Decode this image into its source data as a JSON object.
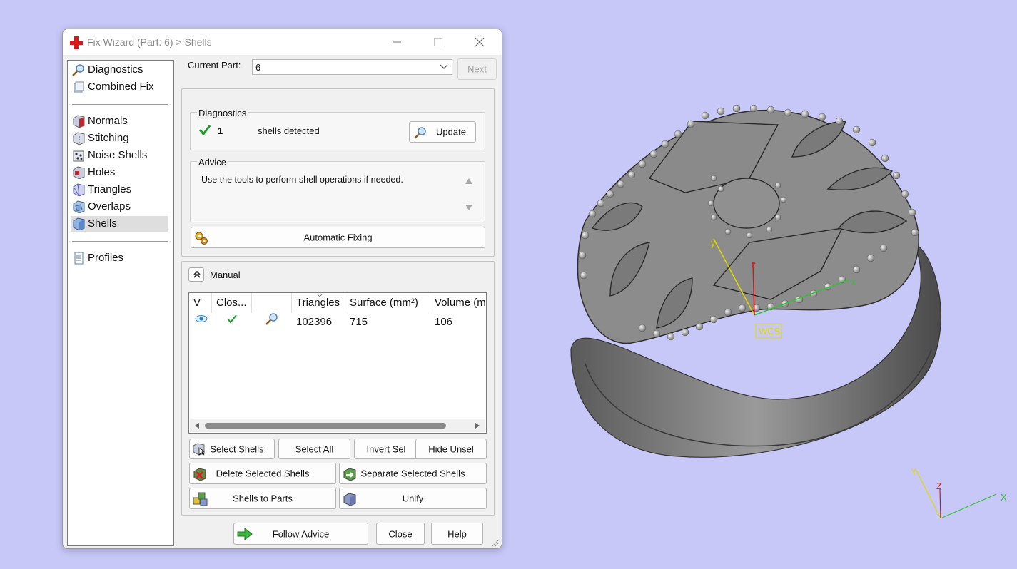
{
  "window": {
    "title": "Fix Wizard (Part: 6) > Shells",
    "controls": [
      "minimize",
      "maximize",
      "close"
    ]
  },
  "nav": {
    "items": [
      {
        "label": "Diagnostics",
        "icon": "magnifier-icon"
      },
      {
        "label": "Combined Fix",
        "icon": "combined-fix-icon"
      },
      {
        "label": "Normals",
        "icon": "normals-icon"
      },
      {
        "label": "Stitching",
        "icon": "stitching-icon"
      },
      {
        "label": "Noise Shells",
        "icon": "noise-shells-icon"
      },
      {
        "label": "Holes",
        "icon": "holes-icon"
      },
      {
        "label": "Triangles",
        "icon": "triangles-icon"
      },
      {
        "label": "Overlaps",
        "icon": "overlaps-icon"
      },
      {
        "label": "Shells",
        "icon": "shells-icon",
        "selected": true
      },
      {
        "label": "Profiles",
        "icon": "profiles-icon"
      }
    ]
  },
  "part": {
    "label": "Current Part:",
    "value": "6",
    "next_label": "Next"
  },
  "diagnostics": {
    "title": "Diagnostics",
    "count": "1",
    "status_text": "shells detected",
    "update_label": "Update"
  },
  "advice": {
    "title": "Advice",
    "text": "Use the tools to perform shell operations if needed."
  },
  "automatic_fixing_label": "Automatic Fixing",
  "manual": {
    "title": "Manual",
    "columns": [
      "V",
      "Clos...",
      "",
      "Triangles",
      "Surface (mm²)",
      "Volume (m"
    ],
    "rows": [
      {
        "triangles": "102396",
        "surface": "715",
        "volume": "106"
      }
    ]
  },
  "buttons": {
    "select_shells": "Select Shells",
    "select_all": "Select All",
    "invert_sel": "Invert Sel",
    "hide_unsel": "Hide Unsel",
    "delete_selected": "Delete Selected Shells",
    "separate_selected": "Separate Selected Shells",
    "shells_to_parts": "Shells to Parts",
    "unify": "Unify",
    "follow_advice": "Follow Advice",
    "close": "Close",
    "help": "Help"
  },
  "viewport": {
    "wcs_label": "WCS",
    "axis_x": "x",
    "axis_y": "y",
    "axis_z": "z",
    "corner_x": "X",
    "corner_y": "Y",
    "corner_z": "Z"
  },
  "colors": {
    "background": "#c8c8f8",
    "axis_x": "#2fc42f",
    "axis_y": "#e0d800",
    "axis_z": "#d01818",
    "check_green": "#1c9a2a",
    "logo_red": "#d61a1a"
  }
}
